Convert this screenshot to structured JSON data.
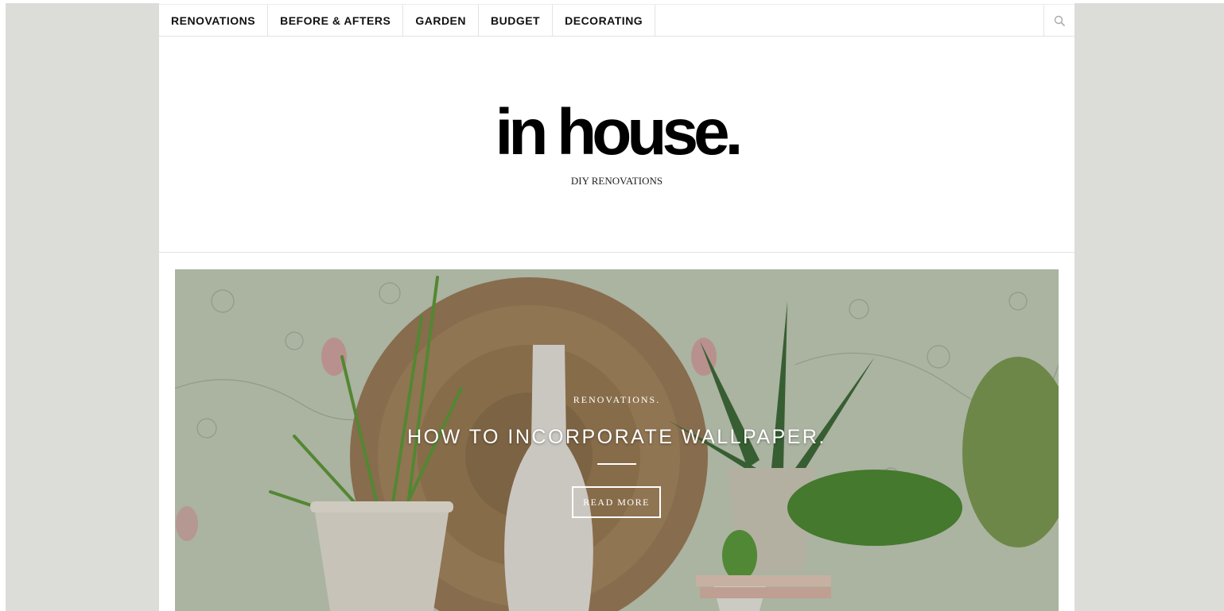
{
  "nav": {
    "items": [
      {
        "label": "RENOVATIONS"
      },
      {
        "label": "BEFORE & AFTERS"
      },
      {
        "label": "GARDEN"
      },
      {
        "label": "BUDGET"
      },
      {
        "label": "DECORATING"
      }
    ],
    "search_icon": "search-icon"
  },
  "header": {
    "logo": "in house.",
    "tagline": "DIY RENOVATIONS"
  },
  "hero": {
    "category": "RENOVATIONS.",
    "title": "HOW TO INCORPORATE WALLPAPER.",
    "button_label": "READ MORE"
  },
  "colors": {
    "backdrop": "#dcddd8",
    "text": "#111111",
    "hero_text": "#ffffff"
  }
}
